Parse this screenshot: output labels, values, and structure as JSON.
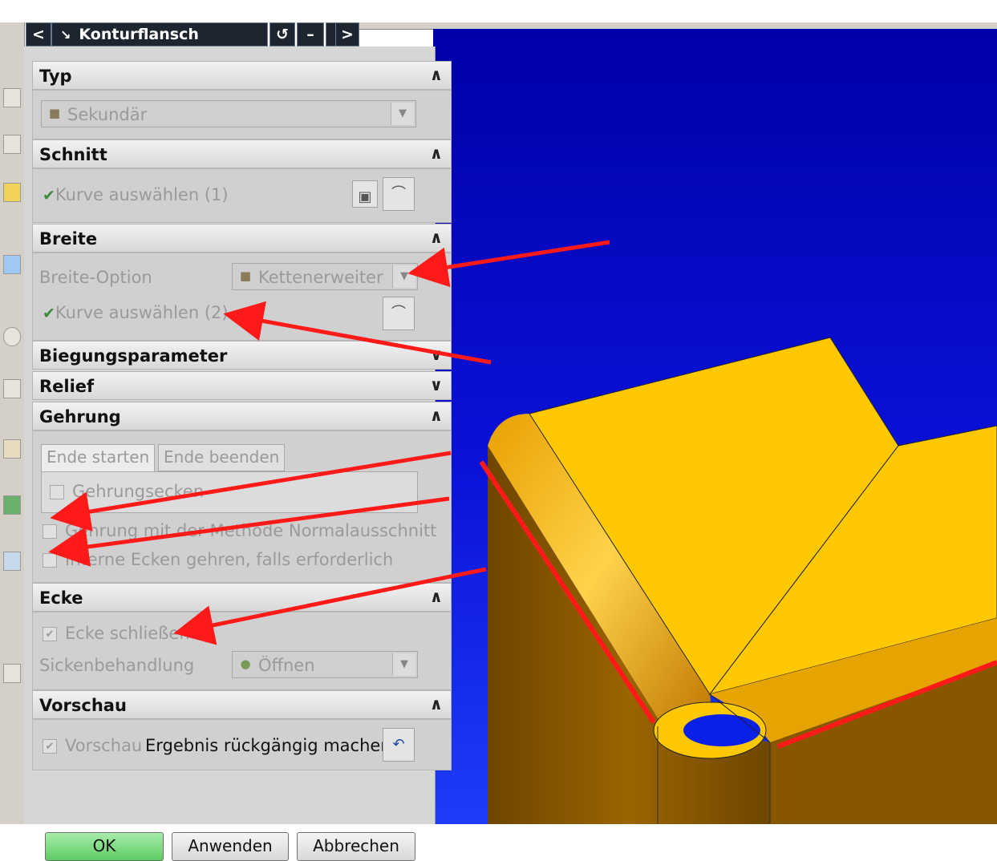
{
  "dialog": {
    "title": "Konturflansch",
    "nav_prev": "<",
    "nav_next": ">",
    "reset_symbol": "↺",
    "minimize_symbol": "–",
    "close_symbol": "×",
    "chevron_up": "∧",
    "chevron_down": "∨"
  },
  "groups": {
    "typ": {
      "label": "Typ",
      "value": "Sekundär"
    },
    "schnitt": {
      "label": "Schnitt",
      "select_curve": "Kurve auswählen (1)"
    },
    "breite": {
      "label": "Breite",
      "option_label": "Breite-Option",
      "option_value": "Kettenerweiterung",
      "select_curve": "Kurve auswählen (2)"
    },
    "biegungsparameter": {
      "label": "Biegungsparameter"
    },
    "relief": {
      "label": "Relief"
    },
    "gehrung": {
      "label": "Gehrung",
      "tab_start": "Ende starten",
      "tab_end": "Ende beenden",
      "gehrungsecken": "Gehrungsecken",
      "normalausschnitt": "Gehrung mit der Methode Normalausschnitt",
      "interne_ecken": "Interne Ecken gehren, falls erforderlich"
    },
    "ecke": {
      "label": "Ecke",
      "close_corner": "Ecke schließen",
      "sicken_label": "Sickenbehandlung",
      "sicken_value": "Öffnen"
    },
    "vorschau": {
      "label": "Vorschau",
      "preview": "Vorschau",
      "undo": "Ergebnis rückgängig machen"
    }
  },
  "buttons": {
    "ok": "OK",
    "apply": "Anwenden",
    "cancel": "Abbrechen"
  },
  "colors": {
    "viewport_blue": "#0a12d8",
    "part_yellow": "#ffc800",
    "part_brown": "#8a5a00",
    "annotation_red": "#ff1a1a",
    "ok_green": "#7fd97f"
  }
}
